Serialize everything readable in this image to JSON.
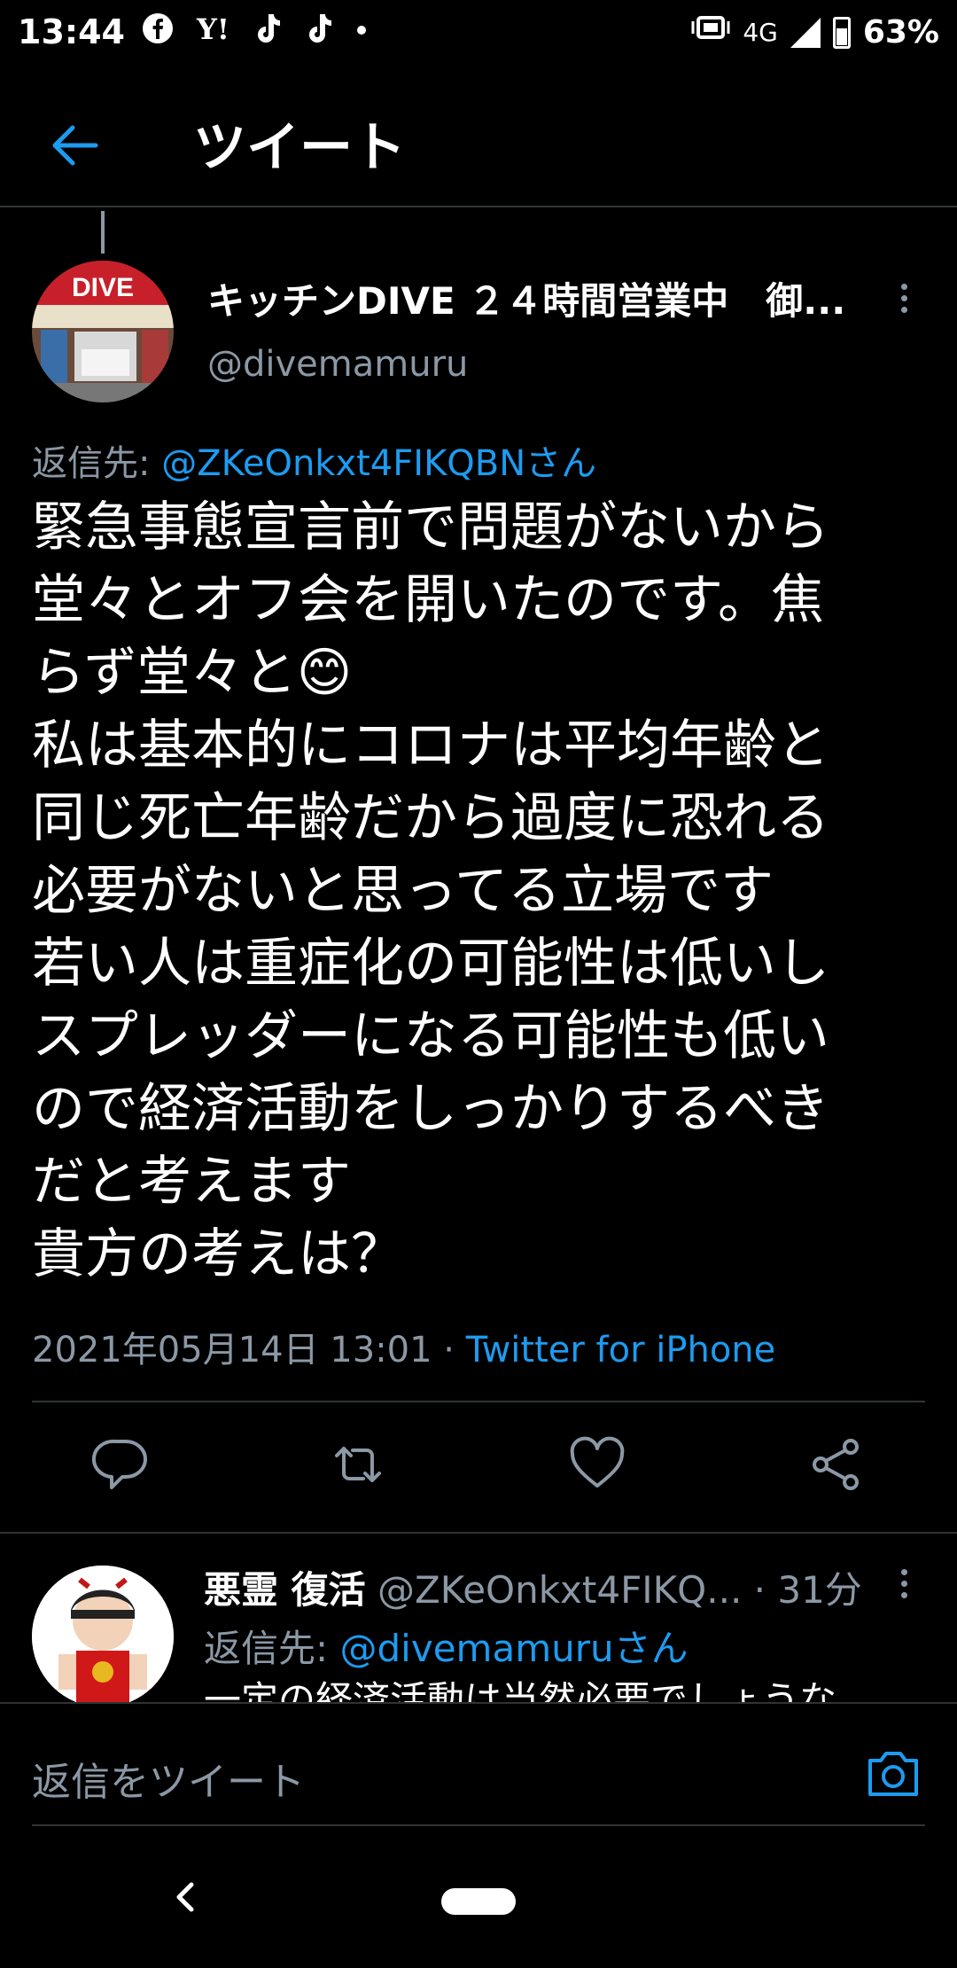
{
  "status_bar": {
    "time": "13:44",
    "left_icons": [
      "facebook-icon",
      "yahoo-icon",
      "tiktok-icon",
      "tiktok-icon",
      "dot-icon"
    ],
    "network": "4G",
    "battery": "63%"
  },
  "header": {
    "title": "ツイート"
  },
  "tweet": {
    "author_name": "キッチンDIVE ２４時間営業中　御...",
    "author_handle": "@divemamuru",
    "reply_to_prefix": "返信先: ",
    "reply_to_handle": "@ZKeOnkxt4FIKQBNさん",
    "text": "緊急事態宣言前で問題がないから\n堂々とオフ会を開いたのです。焦\nらず堂々と😊\n私は基本的にコロナは平均年齢と\n同じ死亡年齢だから過度に恐れる\n必要がないと思ってる立場です\n若い人は重症化の可能性は低いし\nスプレッダーになる可能性も低い\nので経済活動をしっかりするべき\nだと考えます\n貴方の考えは？",
    "timestamp": "2021年05月14日 13:01",
    "separator": " · ",
    "source": "Twitter for iPhone",
    "avatar_sign": "DIVE"
  },
  "reply": {
    "author_name": "悪霊 復活",
    "author_handle": "@ZKeOnkxt4FIKQ...",
    "time": "· 31分",
    "reply_to_prefix": "返信先: ",
    "reply_to_handle": "@divemamuruさん",
    "text": "一定の経済活動は当然必要でしょうな"
  },
  "compose": {
    "placeholder": "返信をツイート"
  },
  "colors": {
    "background": "#000000",
    "accent": "#1d9bf0",
    "secondary_text": "#8b98a5",
    "divider": "#2f3336"
  }
}
